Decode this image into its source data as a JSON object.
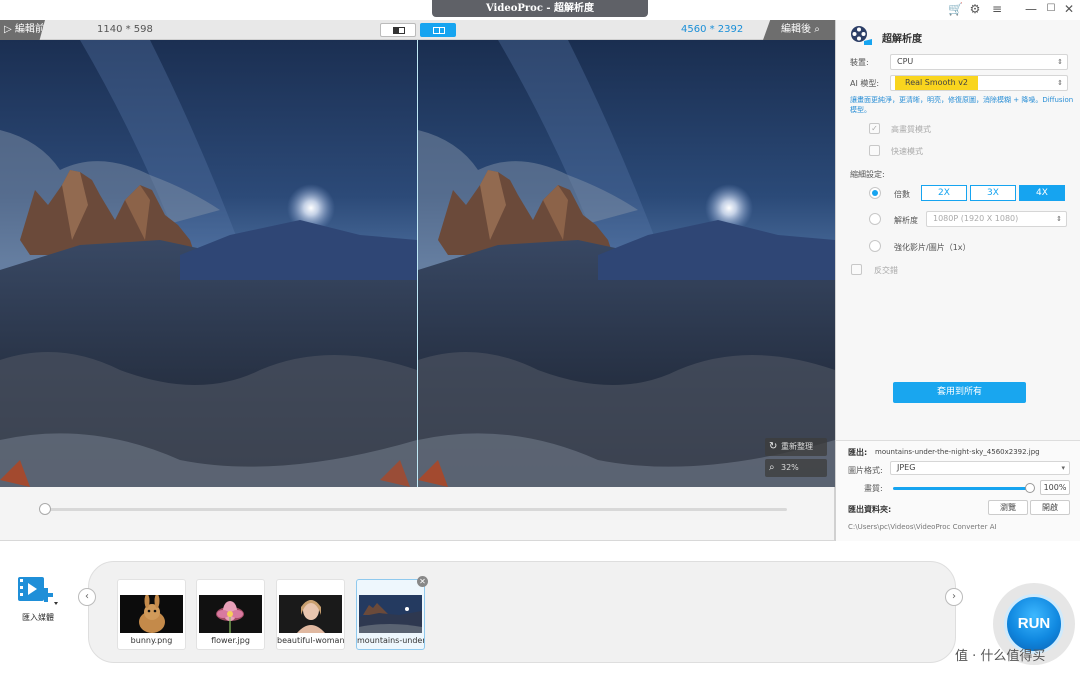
{
  "window": {
    "title": "VideoProc - 超解析度",
    "icons": [
      "cart-icon",
      "gear-icon",
      "menu-icon",
      "minimize-icon",
      "maximize-icon",
      "close-icon"
    ]
  },
  "compare": {
    "before_label": "編輯前",
    "after_label": "編輯後",
    "before_resolution": "1140 * 598",
    "after_resolution": "4560 * 2392"
  },
  "preview": {
    "reorganize_label": "重新整理",
    "zoom_label": "32%"
  },
  "panel": {
    "title": "超解析度",
    "device_label": "裝置:",
    "device_value": "CPU",
    "model_label": "AI 模型:",
    "model_value": "Real Smooth v2",
    "model_hint": "讓畫面更純淨，更清晰，明亮，修復原圖，消除模糊 + 降噪。Diffusion 模型。",
    "hq_mode_label": "高畫質模式",
    "fast_mode_label": "快速模式",
    "scale_settings_label": "縮細設定:",
    "multiple_label": "倍數",
    "scale_options": [
      "2X",
      "3X",
      "4X"
    ],
    "scale_selected": "4X",
    "resolution_label": "解析度",
    "resolution_value": "1080P (1920 X 1080)",
    "enhance_label": "強化影片/圖片（1x）",
    "reverse_label": "反交錯",
    "apply_all_label": "套用到所有"
  },
  "export": {
    "output_label": "匯出:",
    "output_file": "mountains-under-the-night-sky_4560x2392.jpg",
    "format_label": "圖片格式:",
    "format_value": "JPEG",
    "quality_label": "畫質:",
    "quality_value": "100%",
    "quality_level": 100,
    "folder_label": "匯出資料夾:",
    "browse_label": "瀏覽",
    "open_label": "開啟",
    "folder_path": "C:\\Users\\pc\\Videos\\VideoProc Converter AI"
  },
  "media": {
    "import_label": "匯入媒體",
    "items": [
      {
        "name": "bunny.png"
      },
      {
        "name": "flower.jpg"
      },
      {
        "name": "beautiful-woman-"
      },
      {
        "name": "mountains-under-"
      }
    ]
  },
  "run": {
    "label": "RUN"
  },
  "watermark": "值 · 什么值得买",
  "colors": {
    "accent": "#16a4f0",
    "model_highlight": "#f9d51e",
    "hint_text": "#2a8fd6"
  }
}
